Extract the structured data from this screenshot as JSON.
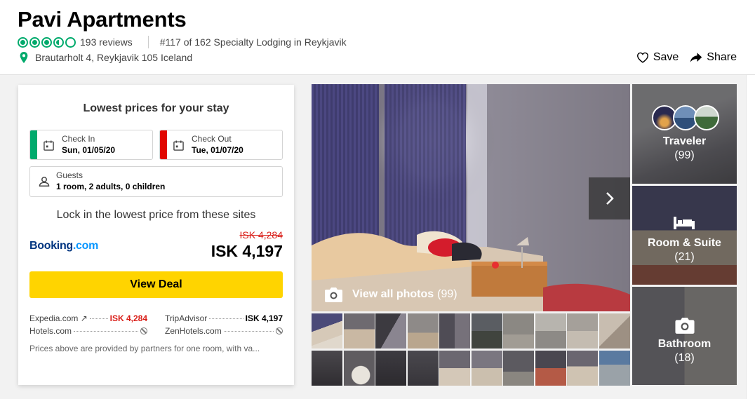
{
  "header": {
    "title": "Pavi Apartments",
    "rating_bubbles": 3.5,
    "reviews": "193 reviews",
    "rank": "#117 of 162 Specialty Lodging in Reykjavik",
    "address": "Brautarholt 4, Reykjavik 105 Iceland",
    "save_label": "Save",
    "share_label": "Share"
  },
  "booking": {
    "title": "Lowest prices for your stay",
    "check_in_label": "Check In",
    "check_in_value": "Sun, 01/05/20",
    "check_out_label": "Check Out",
    "check_out_value": "Tue, 01/07/20",
    "guests_label": "Guests",
    "guests_value": "1 room, 2 adults, 0 children",
    "lock_text": "Lock in the lowest price from these sites",
    "provider_logo_text": "Booking",
    "provider_logo_suffix": ".com",
    "old_price": "ISK 4,284",
    "new_price": "ISK 4,197",
    "view_deal_label": "View Deal",
    "partners": [
      {
        "name": "Expedia.com ↗",
        "price": "ISK 4,284"
      },
      {
        "name": "TripAdvisor",
        "price": "ISK 4,197"
      },
      {
        "name": "Hotels.com",
        "price": ""
      },
      {
        "name": "ZenHotels.com",
        "price": ""
      }
    ],
    "disclaimer": "Prices above are provided by partners for one room, with va..."
  },
  "gallery": {
    "view_all_label": "View all photos",
    "view_all_count": "(99)",
    "categories": [
      {
        "label": "Traveler",
        "count": "(99)"
      },
      {
        "label": "Room & Suite",
        "count": "(21)"
      },
      {
        "label": "Bathroom",
        "count": "(18)"
      }
    ]
  },
  "colors": {
    "accent_green": "#00aa6c",
    "check_in_stripe": "#00aa6c",
    "check_out_stripe": "#e10600",
    "deal_button": "#ffd400",
    "price_red": "#d91e18",
    "booking_blue": "#003580"
  }
}
